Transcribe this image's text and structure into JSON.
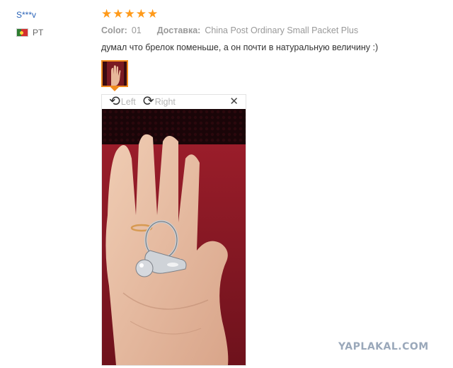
{
  "review": {
    "user_name": "S***v",
    "country_code": "PT",
    "rating_stars": 5,
    "color_label": "Color:",
    "color_value": "01",
    "shipping_label": "Доставка:",
    "shipping_value": "China Post Ordinary Small Packet Plus",
    "text": "думал что брелок поменьше, а он почти в натуральную величину :)"
  },
  "viewer": {
    "rotate_left_label": "Left",
    "rotate_right_label": "Right",
    "close_icon": "close-icon",
    "rotate_left_icon": "rotate-left-icon",
    "rotate_right_icon": "rotate-right-icon"
  },
  "watermark": "YAPLAKAL.COM",
  "colors": {
    "accent_star": "#ff9a1a",
    "username": "#2a63b8",
    "thumb_border": "#f08a1e"
  }
}
